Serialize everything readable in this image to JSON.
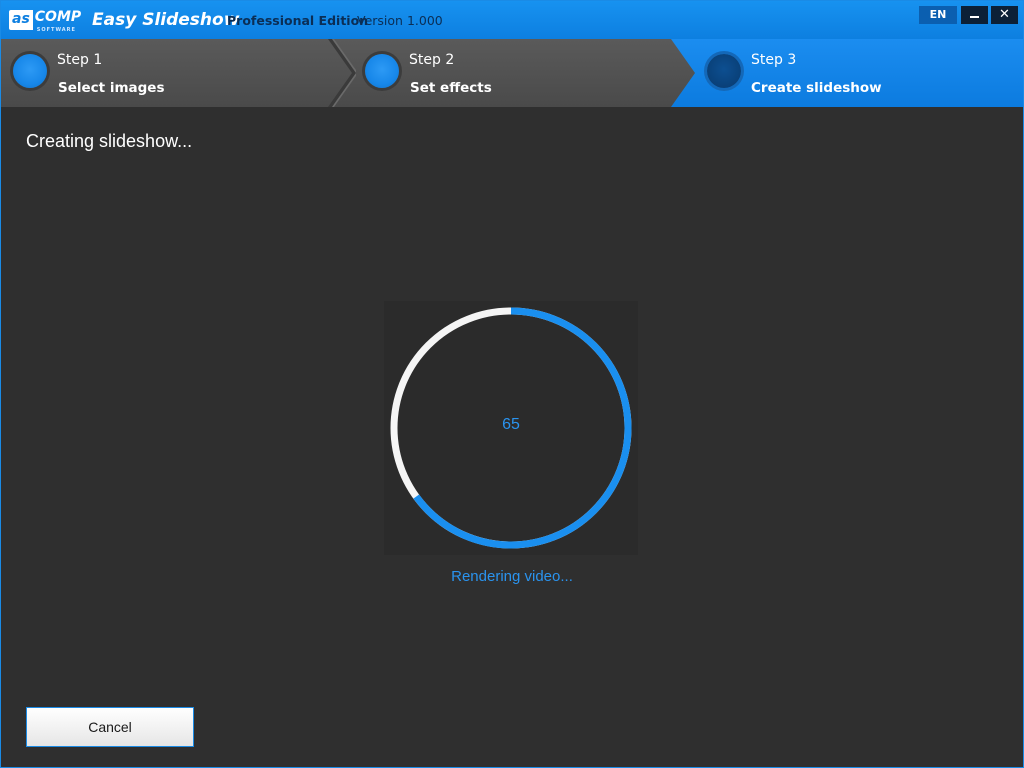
{
  "titlebar": {
    "logo_mark": "as",
    "logo_text": "COMP",
    "logo_sub": "SOFTWARE",
    "app_title": "Easy Slideshow",
    "edition": "Professional Edition",
    "version": "Version 1.000",
    "language": "EN",
    "colors": {
      "bar": "#0d7fe0"
    }
  },
  "steps": [
    {
      "number": "Step 1",
      "name": "Select images",
      "active": false
    },
    {
      "number": "Step 2",
      "name": "Set effects",
      "active": false
    },
    {
      "number": "Step 3",
      "name": "Create slideshow",
      "active": true
    }
  ],
  "main": {
    "status_title": "Creating slideshow...",
    "progress": {
      "value": 65,
      "caption": "Rendering video..."
    },
    "cancel_label": "Cancel"
  },
  "colors": {
    "accent": "#1a8fef",
    "track": "#f5f5f5",
    "background": "#2f2f2f"
  }
}
